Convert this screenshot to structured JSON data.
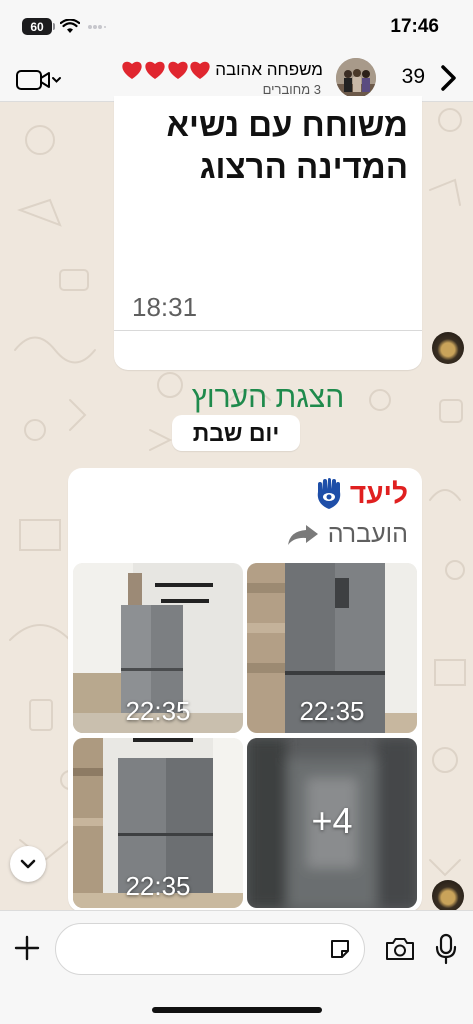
{
  "status_bar": {
    "battery": "60",
    "time": "17:46"
  },
  "header": {
    "back_count": "39",
    "group_name": "משפחה אהובה",
    "subtitle": "3 מחוברים",
    "video_icon": "video-call-icon",
    "heart_icon": "red-heart-icon"
  },
  "messages": {
    "card1": {
      "title": "משוחח עם נשיא המדינה הרצוג",
      "time": "18:31",
      "link_label": "הצגת הערוץ"
    },
    "date_chip": "יום שבת",
    "card2": {
      "sender": "ליעד",
      "sender_color": "#e02020",
      "forwarded_label": "הועברה",
      "photos": [
        {
          "time": "22:35"
        },
        {
          "time": "22:35"
        },
        {
          "time": "22:35"
        },
        {
          "more": "+4"
        }
      ]
    }
  },
  "colors": {
    "link_green": "#1f8a4c",
    "chat_bg": "#efe7dd"
  },
  "input_bar": {
    "icons": [
      "plus-icon",
      "sticker-icon",
      "camera-icon",
      "microphone-icon"
    ]
  }
}
